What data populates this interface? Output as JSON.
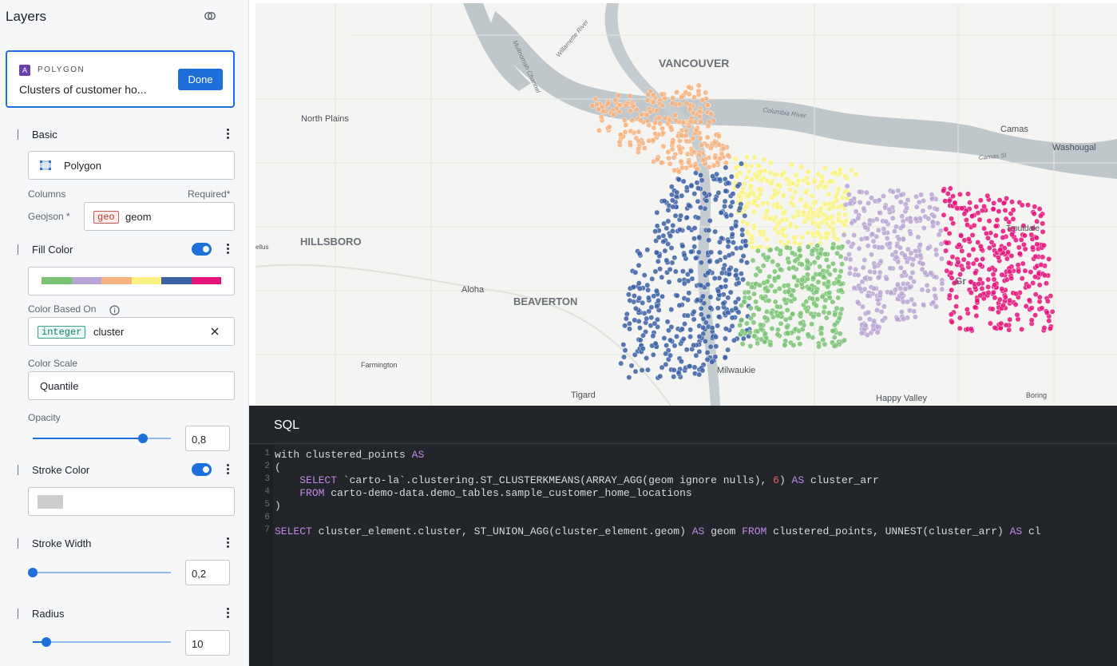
{
  "sidebar": {
    "title": "Layers",
    "layer": {
      "badge": "A",
      "type": "POLYGON",
      "name": "Clusters of customer ho...",
      "done_label": "Done"
    },
    "basic": {
      "label": "Basic",
      "geometry_type": "Polygon",
      "columns_label": "Columns",
      "required_label": "Required*",
      "geojson_label": "Geojson *",
      "geo_chip": "geo",
      "geo_column": "geom"
    },
    "fill_color": {
      "label": "Fill Color",
      "enabled": true,
      "palette": [
        "#7ac374",
        "#b9a5d4",
        "#f6b27f",
        "#f9f283",
        "#3b60a6",
        "#e4137a"
      ],
      "based_on_label": "Color Based On",
      "type_chip": "integer",
      "column": "cluster",
      "scale_label": "Color Scale",
      "scale_value": "Quantile",
      "opacity_label": "Opacity",
      "opacity_value": "0,8",
      "opacity_fraction": 0.8
    },
    "stroke_color": {
      "label": "Stroke Color",
      "enabled": true,
      "color": "#cccccc"
    },
    "stroke_width": {
      "label": "Stroke Width",
      "value": "0,2",
      "fraction": 0.0
    },
    "radius": {
      "label": "Radius",
      "value": "10",
      "fraction": 0.1
    }
  },
  "map": {
    "labels": {
      "vancouver": "VANCOUVER",
      "north_plains": "North Plains",
      "hillsboro": "HILLSBORO",
      "aloha": "Aloha",
      "beaverton": "BEAVERTON",
      "farmington": "Farmington",
      "tigard": "Tigard",
      "milwaukie": "Milwaukie",
      "happy_valley": "Happy Valley",
      "boring": "Boring",
      "camas": "Camas",
      "washougal": "Washougal",
      "troutdale": "Troutdale",
      "gresham": "Gr",
      "ellus": "ellus",
      "columbia_river": "Columbia River",
      "willamette_river": "Willamette River",
      "multnomah_channel": "Multnomah Channel",
      "camas_slough": "Camas Sl"
    }
  },
  "sql": {
    "title": "SQL",
    "lines": [
      {
        "n": "1",
        "text": "with clustered_points AS"
      },
      {
        "n": "2",
        "text": "("
      },
      {
        "n": "3",
        "text": "    SELECT `carto-la`.clustering.ST_CLUSTERKMEANS(ARRAY_AGG(geom ignore nulls), 6) AS cluster_arr"
      },
      {
        "n": "4",
        "text": "    FROM carto-demo-data.demo_tables.sample_customer_home_locations"
      },
      {
        "n": "5",
        "text": ")"
      },
      {
        "n": "6",
        "text": ""
      },
      {
        "n": "7",
        "text": "SELECT cluster_element.cluster, ST_UNION_AGG(cluster_element.geom) AS geom FROM clustered_points, UNNEST(cluster_arr) AS cl"
      }
    ]
  }
}
